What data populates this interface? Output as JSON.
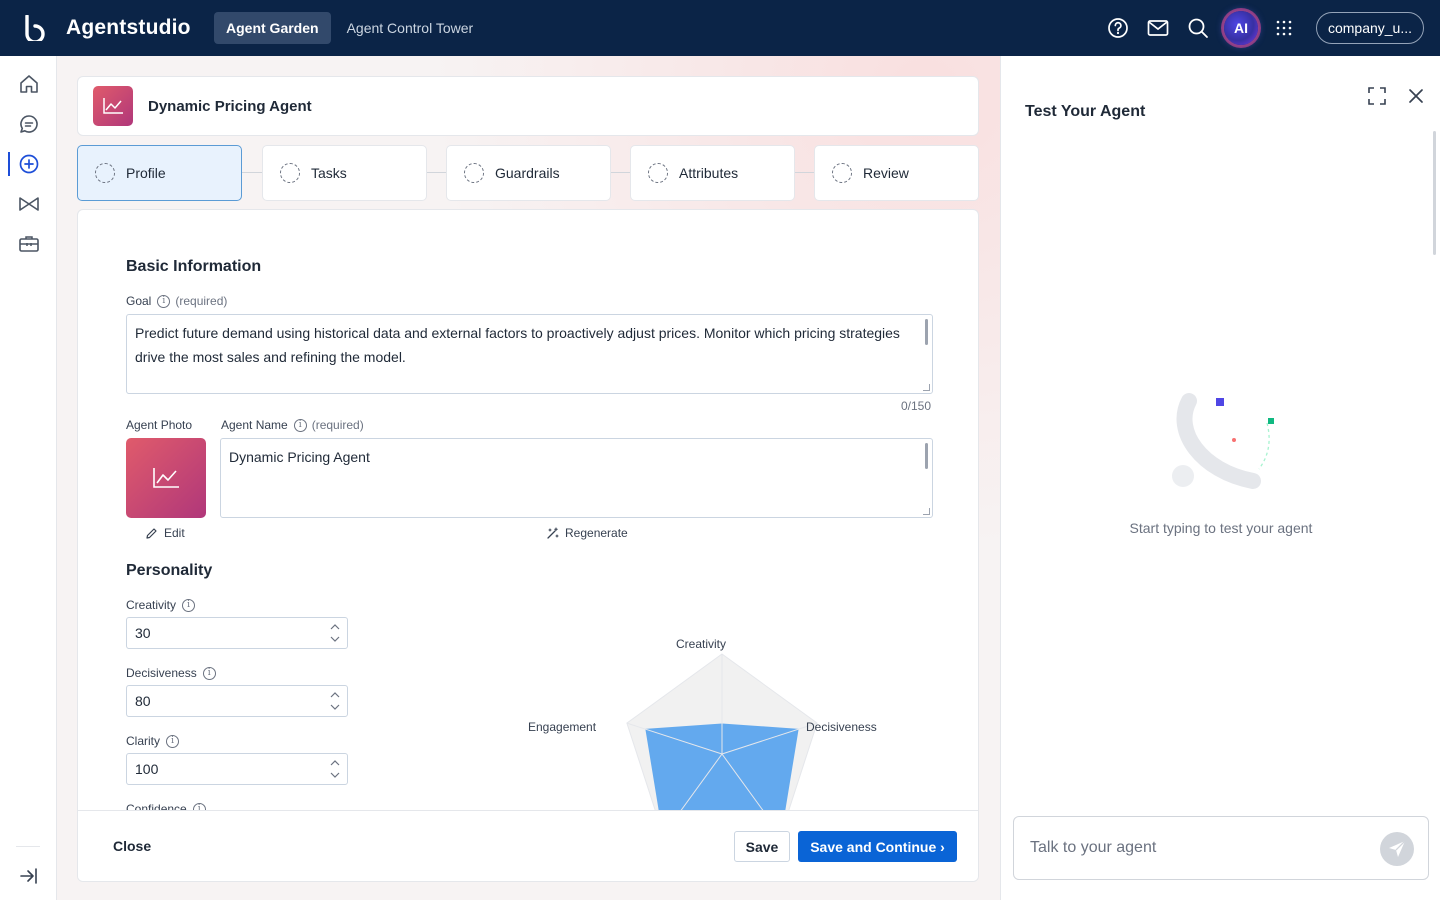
{
  "app": {
    "brand": "Agentstudio"
  },
  "nav": {
    "tabs": [
      {
        "label": "Agent Garden"
      },
      {
        "label": "Agent Control Tower"
      }
    ]
  },
  "topbar": {
    "ai_label": "AI",
    "company": "company_u..."
  },
  "agent": {
    "title": "Dynamic Pricing Agent"
  },
  "steps": [
    {
      "label": "Profile"
    },
    {
      "label": "Tasks"
    },
    {
      "label": "Guardrails"
    },
    {
      "label": "Attributes"
    },
    {
      "label": "Review"
    }
  ],
  "form": {
    "basic_title": "Basic Information",
    "goal_label": "Goal",
    "required": "(required)",
    "goal_value": "Predict future demand using historical data and external factors to proactively adjust prices. Monitor which pricing strategies drive the most sales and refining the model.",
    "goal_counter": "0/150",
    "photo_label": "Agent Photo",
    "name_label": "Agent Name",
    "name_value": "Dynamic Pricing Agent",
    "edit_label": "Edit",
    "regenerate_label": "Regenerate",
    "personality_title": "Personality",
    "creativity_label": "Creativity",
    "creativity_value": "30",
    "decisiveness_label": "Decisiveness",
    "decisiveness_value": "80",
    "clarity_label": "Clarity",
    "clarity_value": "100",
    "confidence_label": "Confidence"
  },
  "chart_data": {
    "type": "radar",
    "axes": [
      "Creativity",
      "Decisiveness",
      "Clarity",
      "Confidence",
      "Engagement"
    ],
    "values": [
      30,
      80,
      100,
      100,
      80
    ],
    "range": [
      0,
      100
    ],
    "fill_color": "#63a9ee",
    "grid_color": "#f1f1f1"
  },
  "footer": {
    "close": "Close",
    "save": "Save",
    "save_continue": "Save and Continue ›"
  },
  "test_panel": {
    "title": "Test Your Agent",
    "empty_text": "Start typing to test your agent",
    "input_placeholder": "Talk to your agent"
  },
  "colors": {
    "topbar": "#0b2447",
    "primary": "#0a64d6",
    "accent": "#b0377a"
  }
}
